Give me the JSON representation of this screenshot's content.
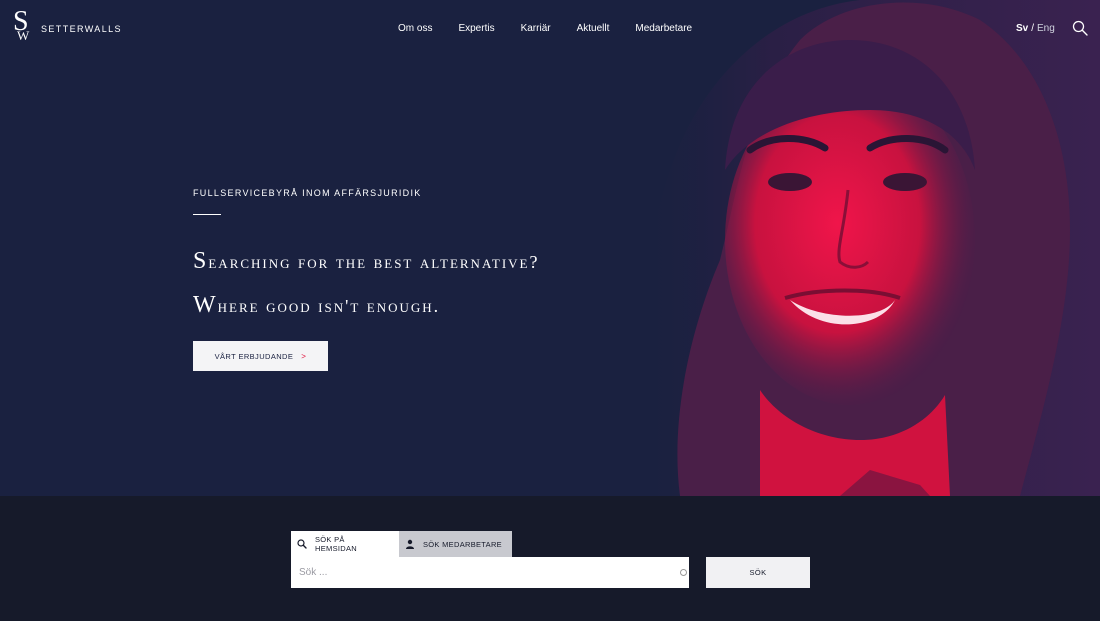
{
  "brand": {
    "name": "SETTERWALLS",
    "mark_s": "S",
    "mark_w": "W"
  },
  "nav": {
    "items": [
      {
        "label": "Om oss"
      },
      {
        "label": "Expertis"
      },
      {
        "label": "Karriär"
      },
      {
        "label": "Aktuellt"
      },
      {
        "label": "Medarbetare"
      }
    ]
  },
  "language": {
    "active": "Sv",
    "separator": "/",
    "other": "Eng"
  },
  "hero": {
    "kicker": "FULLSERVICEBYRÅ INOM AFFÄRSJURIDIK",
    "headline_line1": "Searching for the best alternative?",
    "headline_line2": "Where good isn't enough.",
    "cta_label": "VÅRT ERBJUDANDE",
    "cta_arrow": ">"
  },
  "search": {
    "tabs": [
      {
        "label": "SÖK PÅ HEMSIDAN",
        "icon": "search-icon"
      },
      {
        "label": "SÖK MEDARBETARE",
        "icon": "person-icon"
      }
    ],
    "placeholder": "Sök ...",
    "submit_label": "SÖK"
  },
  "colors": {
    "hero_bg": "#1a2140",
    "accent_red": "#e0133d",
    "footer_bg": "#161a2a"
  }
}
